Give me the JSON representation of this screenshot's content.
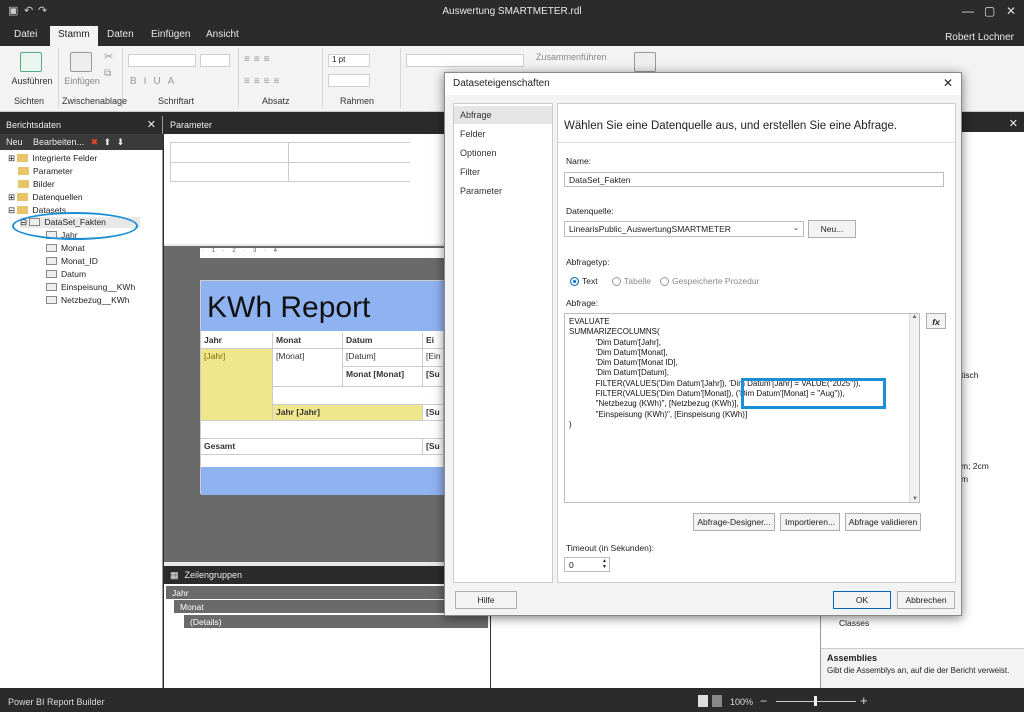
{
  "window": {
    "title": "Auswertung SMARTMETER.rdl",
    "user": "Robert Lochner"
  },
  "tabs": [
    "Datei",
    "Stamm",
    "Daten",
    "Einfügen",
    "Ansicht"
  ],
  "ribbon": {
    "run": "Ausführen",
    "paste": "Einfügen",
    "groups": [
      "Sichten",
      "Zwischenablage",
      "Schriftart",
      "Absatz",
      "Rahmen"
    ],
    "merge": "Zusammenführen",
    "pt": "1 pt"
  },
  "left": {
    "title": "Berichtsdaten",
    "new": "Neu",
    "edit": "Bearbeiten...",
    "tree": [
      "Integrierte Felder",
      "Parameter",
      "Bilder",
      "Datenquellen",
      "Datasets",
      "DataSet_Fakten",
      "Jahr",
      "Monat",
      "Monat_ID",
      "Datum",
      "Einspeisung__KWh",
      "Netzbezug__KWh"
    ]
  },
  "params": {
    "title": "Parameter"
  },
  "report": {
    "title": "KWh Report",
    "headers": [
      "Jahr",
      "Monat",
      "Datum",
      "Ei"
    ],
    "row1": [
      "[Jahr]",
      "[Monat]",
      "[Datum]",
      "[Ein"
    ],
    "row2": [
      "Monat [Monat]",
      "[Su"
    ],
    "row3": [
      "Jahr [Jahr]",
      "[Su"
    ],
    "row4": [
      "Gesamt",
      "[Su"
    ]
  },
  "groups": {
    "title": "Zeilengruppen",
    "items": [
      "Jahr",
      "Monat",
      "(Details)"
    ]
  },
  "dialog": {
    "title": "Dataseteigenschaften",
    "nav": [
      "Abfrage",
      "Felder",
      "Optionen",
      "Filter",
      "Parameter"
    ],
    "heading": "Wählen Sie eine Datenquelle aus, und erstellen Sie eine Abfrage.",
    "name_label": "Name:",
    "name_value": "DataSet_Fakten",
    "source_label": "Datenquelle:",
    "source_value": "LinearisPublic_AuswertungSMARTMETER",
    "new_btn": "Neu...",
    "type_label": "Abfragetyp:",
    "type_options": [
      "Text",
      "Tabelle",
      "Gespeicherte Prozedur"
    ],
    "query_label": "Abfrage:",
    "query_lines": [
      "EVALUATE",
      "SUMMARIZECOLUMNS(",
      "            'Dim Datum'[Jahr],",
      "            'Dim Datum'[Monat],",
      "            'Dim Datum'[Monat ID],",
      "            'Dim Datum'[Datum],",
      "            FILTER(VALUES('Dim Datum'[Jahr]), 'Dim Datum'[Jahr] = VALUE(\"2025\")),",
      "            FILTER(VALUES('Dim Datum'[Monat]), ('Dim Datum'[Monat] = \"Aug\")),",
      "            \"Netzbezug (KWh)\", [Netzbezug (KWh)],",
      "            \"Einspeisung (KWh)\", [Einspeisung (KWh)]",
      ")"
    ],
    "fx": "fx",
    "buttons": [
      "Abfrage-Designer...",
      "Importieren...",
      "Abfrage validieren"
    ],
    "timeout_label": "Timeout (in Sekunden):",
    "timeout_value": "0",
    "help": "Hilfe",
    "ok": "OK",
    "cancel": "Abbrechen"
  },
  "right": {
    "frag1": "tisch",
    "frag2": "m; 2cm",
    "frag3": "m",
    "classes": "Classes",
    "assemblies_title": "Assemblies",
    "assemblies_desc": "Gibt die Assemblys an, auf die der Bericht verweist."
  },
  "status": {
    "app": "Power BI Report Builder",
    "zoom": "100%"
  },
  "colors": {
    "accent": "#0067c0",
    "highlight": "#1a8fd6",
    "report_band": "#8fb2f0",
    "yellow": "#f0e68c"
  }
}
